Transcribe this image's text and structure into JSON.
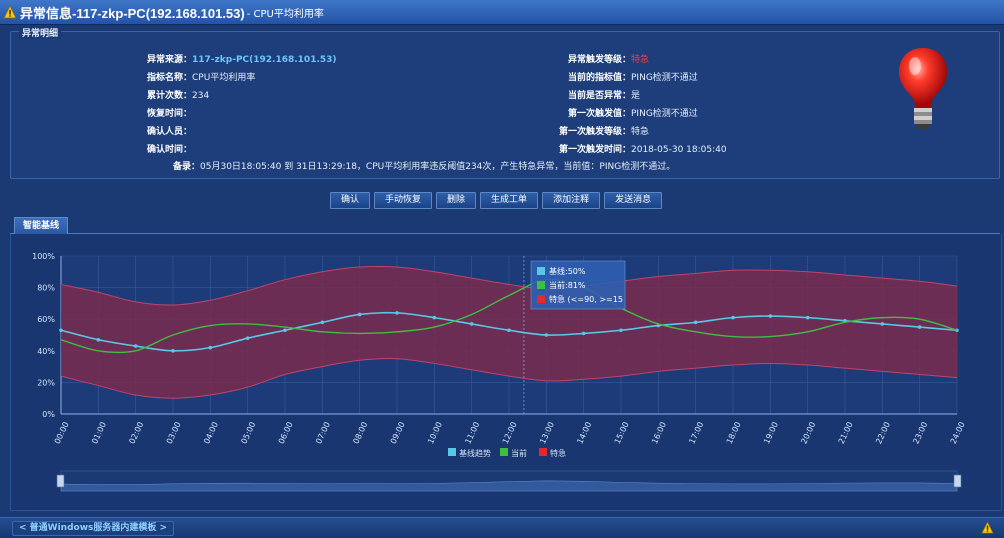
{
  "window": {
    "title": "异常信息-117-zkp-PC(192.168.101.53)",
    "subtitle": "- CPU平均利用率"
  },
  "details": {
    "legend": "异常明细",
    "left": [
      {
        "label": "异常来源：",
        "value": "117-zkp-PC(192.168.101.53)"
      },
      {
        "label": "指标名称：",
        "value": "CPU平均利用率"
      },
      {
        "label": "累计次数：",
        "value": "234"
      },
      {
        "label": "恢复时间：",
        "value": ""
      },
      {
        "label": "确认人员：",
        "value": ""
      },
      {
        "label": "确认时间：",
        "value": ""
      }
    ],
    "right": [
      {
        "label": "异常触发等级：",
        "value": "特急"
      },
      {
        "label": "当前的指标值：",
        "value": "PING检测不通过"
      },
      {
        "label": "当前是否异常：",
        "value": "是"
      },
      {
        "label": "第一次触发值：",
        "value": "PING检测不通过"
      },
      {
        "label": "第一次触发等级：",
        "value": "特急"
      },
      {
        "label": "第一次触发时间：",
        "value": "2018-05-30 18:05:40"
      }
    ],
    "remark_label": "备录：",
    "remark_value": "05月30日18:05:40 到 31日13:29:18，CPU平均利用率违反阈值234次，产生特急异常，当前值：PING检测不通过。"
  },
  "buttons": {
    "confirm": "确认",
    "manual_recover": "手动恢复",
    "delete": "删除",
    "create_ticket": "生成工单",
    "add_note": "添加注释",
    "send_message": "发送消息"
  },
  "tabs": {
    "smart_baseline": "智能基线"
  },
  "tooltip": {
    "baseline": "基线:50%",
    "current": "当前:81%",
    "urgent": "特急 (<=90, >=15"
  },
  "legend": {
    "baseline": "基线趋势",
    "current": "当前",
    "urgent": "特急"
  },
  "footer": {
    "template_link": "< 普通Windows服务器内建模板 >"
  },
  "colors": {
    "baseline": "#58c8e6",
    "current": "#3fbf3f",
    "urgent": "#e8262b",
    "band": "#7a2c4e"
  },
  "chart_data": {
    "type": "line",
    "x": [
      "00:00",
      "01:00",
      "02:00",
      "03:00",
      "04:00",
      "05:00",
      "06:00",
      "07:00",
      "08:00",
      "09:00",
      "10:00",
      "11:00",
      "12:00",
      "13:00",
      "14:00",
      "15:00",
      "16:00",
      "17:00",
      "18:00",
      "19:00",
      "20:00",
      "21:00",
      "22:00",
      "23:00",
      "24:00"
    ],
    "yticks": [
      "0%",
      "20%",
      "40%",
      "60%",
      "80%",
      "100%"
    ],
    "ylim": [
      0,
      100
    ],
    "series": [
      {
        "name": "基线趋势",
        "values": [
          53,
          47,
          43,
          40,
          42,
          48,
          53,
          58,
          63,
          64,
          61,
          57,
          53,
          50,
          51,
          53,
          56,
          58,
          61,
          62,
          61,
          59,
          57,
          55,
          53
        ]
      },
      {
        "name": "当前",
        "values": [
          47,
          40,
          40,
          50,
          56,
          57,
          55,
          52,
          51,
          52,
          55,
          63,
          75,
          85,
          80,
          67,
          57,
          52,
          49,
          49,
          52,
          58,
          61,
          60,
          53
        ]
      },
      {
        "name": "特急",
        "upper": [
          82,
          77,
          71,
          69,
          72,
          78,
          85,
          90,
          93,
          93,
          90,
          86,
          82,
          79,
          81,
          84,
          87,
          89,
          91,
          91,
          90,
          88,
          86,
          84,
          81
        ],
        "lower": [
          24,
          18,
          12,
          10,
          12,
          17,
          25,
          30,
          34,
          35,
          32,
          28,
          24,
          21,
          22,
          24,
          27,
          29,
          31,
          32,
          31,
          29,
          27,
          25,
          23
        ]
      }
    ]
  }
}
